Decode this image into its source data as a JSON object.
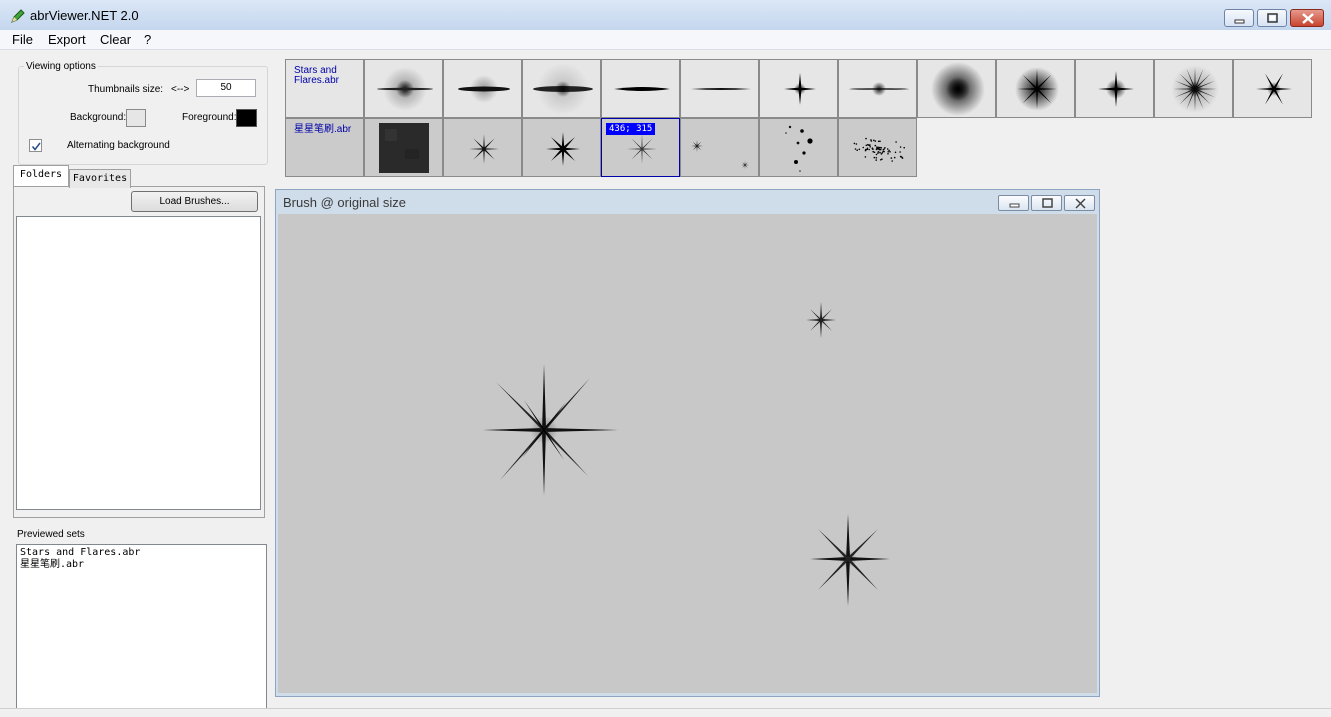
{
  "window": {
    "title": "abrViewer.NET 2.0",
    "icon": "pencil-icon"
  },
  "menu": [
    "File",
    "Export",
    "Clear",
    "?"
  ],
  "viewing_options": {
    "legend": "Viewing options",
    "thumb_size_label": "Thumbnails size:",
    "thumb_size_arrows": "<-->",
    "thumb_size_value": "50",
    "background_label": "Background:",
    "background_color": "#e6e6e6",
    "foreground_label": "Foreground:",
    "foreground_color": "#000000",
    "alternating_label": "Alternating background",
    "alternating_checked": true
  },
  "tabs": [
    "Folders",
    "Favorites"
  ],
  "load_button": "Load Brushes...",
  "previewed": {
    "label": "Previewed sets",
    "items": [
      "Stars and Flares.abr",
      "星星笔刷.abr"
    ]
  },
  "brush_sets": [
    {
      "name": "Stars and Flares.abr",
      "brushes": [
        "flare-soft",
        "flare-thin",
        "flare-wide",
        "flare-line",
        "flare-streak",
        "star-4",
        "flare-dot",
        "glow-large",
        "glow-spiky",
        "star-4-small",
        "star-burst",
        "star-6"
      ]
    },
    {
      "name": "星星笔刷.abr",
      "brushes": [
        "texture-square",
        "star-8",
        "star-8-bold",
        "star-8-thin",
        "stars-scatter",
        "dots-scatter",
        "dots-cloud"
      ]
    }
  ],
  "selected_brush": {
    "set": 1,
    "index": 3,
    "coords": "436; 315"
  },
  "brush_window": {
    "caption": "Brush @ original size",
    "buttons": [
      "minimize-icon",
      "restore-icon",
      "close-icon"
    ]
  }
}
